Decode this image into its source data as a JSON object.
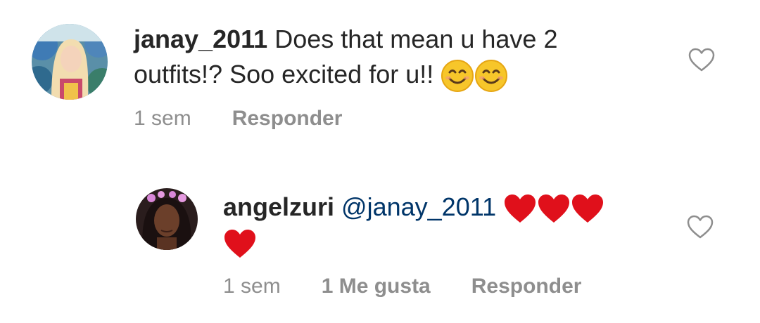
{
  "comments": [
    {
      "username": "janay_2011",
      "text_line1": "Does that mean u have 2",
      "text_line2": "outfits!? Soo excited for u!!",
      "emojis": [
        "smiling-face-icon",
        "smiling-face-icon"
      ],
      "time": "1 sem",
      "reply_label": "Responder"
    },
    {
      "username": "angelzuri",
      "mention": "@janay_2011",
      "emojis": [
        "red-heart-icon",
        "red-heart-icon",
        "red-heart-icon",
        "red-heart-icon"
      ],
      "time": "1 sem",
      "likes_label": "1 Me gusta",
      "reply_label": "Responder"
    }
  ],
  "colors": {
    "text": "#262626",
    "meta": "#8e8e8e",
    "mention": "#003569",
    "heart": "#e0101b"
  }
}
